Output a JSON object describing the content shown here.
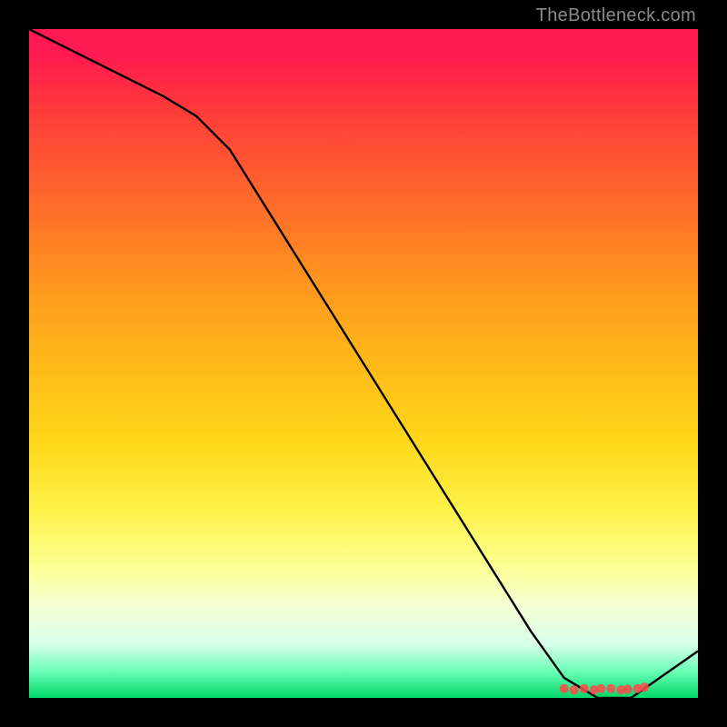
{
  "attribution": "TheBottleneck.com",
  "chart_data": {
    "type": "line",
    "title": "",
    "xlabel": "",
    "ylabel": "",
    "xlim": [
      0,
      100
    ],
    "ylim": [
      0,
      100
    ],
    "x": [
      0,
      5,
      10,
      15,
      20,
      25,
      30,
      35,
      40,
      45,
      50,
      55,
      60,
      65,
      70,
      75,
      80,
      85,
      90,
      95,
      100
    ],
    "values": [
      100,
      97.5,
      95,
      92.5,
      90,
      87,
      82,
      74,
      66,
      58,
      50,
      42,
      34,
      26,
      18,
      10,
      3,
      0,
      0,
      3.5,
      7
    ],
    "markers": {
      "x": [
        80,
        81.5,
        83,
        84.5,
        85.5,
        87,
        88.5,
        89.5,
        91,
        92
      ],
      "y": [
        1.4,
        1.2,
        1.4,
        1.2,
        1.4,
        1.4,
        1.2,
        1.3,
        1.4,
        1.6
      ]
    },
    "background": "rainbow-vertical-gradient",
    "axis_ticks_visible": false,
    "grid": false
  }
}
